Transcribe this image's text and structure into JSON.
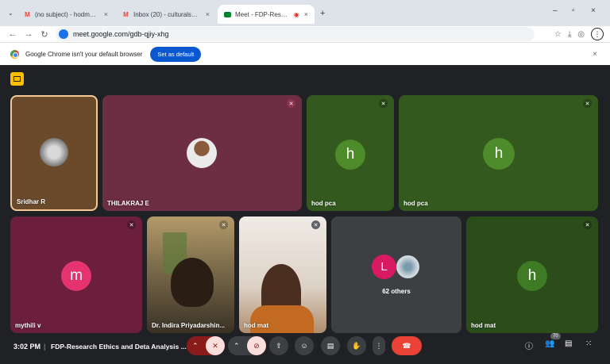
{
  "browser": {
    "tabs": [
      {
        "label": "(no subject) - hodmat@stjosep",
        "favicon": "gmail-icon",
        "close": "×"
      },
      {
        "label": "Inbox (20) - culturals@stjoseph",
        "favicon": "gmail-icon",
        "close": "×"
      },
      {
        "label": "Meet - FDP-Research Ethic",
        "favicon": "meet-icon",
        "close": "×"
      }
    ],
    "new_tab": "+",
    "url": "meet.google.com/gdb-qjiy-xhg",
    "infobar_text": "Google Chrome isn't your default browser",
    "set_default_label": "Set as default",
    "infobar_close": "×",
    "window_controls": [
      "–",
      "▫",
      "×"
    ]
  },
  "meet": {
    "tiles": [
      {
        "name": "Sridhar R",
        "type": "photo",
        "bg": "#6b4a2c"
      },
      {
        "name": "THILAKRAJ E",
        "type": "photo",
        "bg": "#6d2d43"
      },
      {
        "name": "hod pca",
        "type": "letter",
        "letter": "h",
        "bg": "#33591e",
        "avatar": "#4e8b2a"
      },
      {
        "name": "hod pca",
        "type": "letter",
        "letter": "h",
        "bg": "#33591e",
        "avatar": "#4e8b2a"
      },
      {
        "name": "mythili v",
        "type": "letter",
        "letter": "m",
        "bg": "#6b1f3c",
        "avatar": "#e5336f"
      },
      {
        "name": "Dr. Indira Priyadarshin...",
        "type": "video"
      },
      {
        "name": "hod mat",
        "type": "video"
      },
      {
        "name": "62 others",
        "type": "others",
        "letter": "L",
        "bg": "#3c4043",
        "avatar": "#d81b60"
      },
      {
        "name": "hod mat",
        "type": "letter",
        "letter": "h",
        "bg": "#2a4d1a",
        "avatar": "#3f7a24"
      }
    ],
    "bottom": {
      "time": "3:02 PM",
      "separator": "|",
      "meeting_title": "FDP-Research Ethics and Deta Analysis ...",
      "participant_count": "70"
    }
  }
}
